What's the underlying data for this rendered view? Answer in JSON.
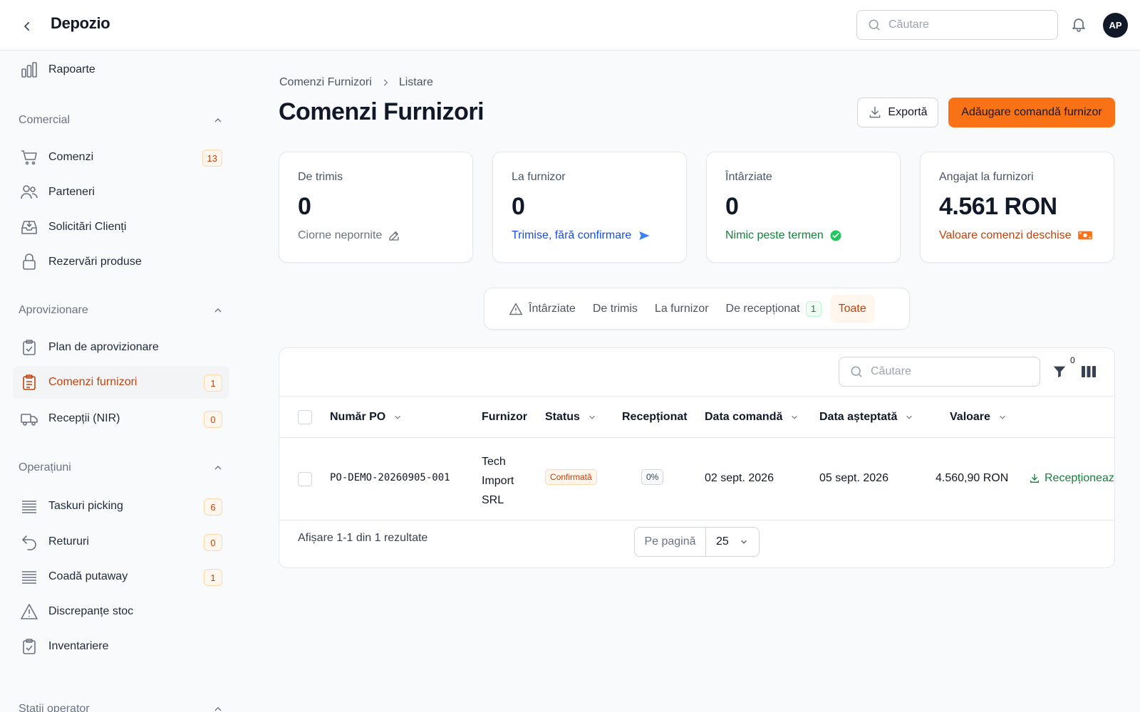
{
  "header": {
    "app_title": "Depozio",
    "search_placeholder": "Căutare",
    "avatar_initials": "AP"
  },
  "sidebar": {
    "top_item": "Rapoarte",
    "sections": [
      {
        "title": "Comercial",
        "items": [
          {
            "label": "Comenzi",
            "badge": "13",
            "icon": "cart-icon"
          },
          {
            "label": "Parteneri",
            "badge": "",
            "icon": "users-icon"
          },
          {
            "label": "Solicitări Clienți",
            "badge": "",
            "icon": "inbox-icon"
          },
          {
            "label": "Rezervări produse",
            "badge": "",
            "icon": "lock-icon"
          }
        ]
      },
      {
        "title": "Aprovizionare",
        "items": [
          {
            "label": "Plan de aprovizionare",
            "badge": "",
            "icon": "clipboard-check-icon"
          },
          {
            "label": "Comenzi furnizori",
            "badge": "1",
            "icon": "clipboard-list-icon",
            "active": true
          },
          {
            "label": "Recepții (NIR)",
            "badge": "0",
            "icon": "truck-icon"
          }
        ]
      },
      {
        "title": "Operațiuni",
        "items": [
          {
            "label": "Taskuri picking",
            "badge": "6",
            "icon": "list-icon"
          },
          {
            "label": "Retururi",
            "badge": "0",
            "icon": "return-icon"
          },
          {
            "label": "Coadă putaway",
            "badge": "1",
            "icon": "list-icon"
          },
          {
            "label": "Discrepanțe stoc",
            "badge": "",
            "icon": "warning-icon"
          },
          {
            "label": "Inventariere",
            "badge": "",
            "icon": "clipboard-check-icon"
          }
        ]
      },
      {
        "title": "Stații operator",
        "items": []
      }
    ]
  },
  "breadcrumb": {
    "parent": "Comenzi Furnizori",
    "current": "Listare"
  },
  "page": {
    "title": "Comenzi Furnizori",
    "export_label": "Exportă",
    "add_label": "Adăugare comandă furnizor"
  },
  "cards": [
    {
      "title": "De trimis",
      "value": "0",
      "sub": "Ciorne neporn­ite",
      "sub_color": "#6b7280"
    },
    {
      "title": "La furnizor",
      "value": "0",
      "sub": "Trimise, fără confirmare",
      "sub_color": "#1d4ed8"
    },
    {
      "title": "Întârziate",
      "value": "0",
      "sub": "Nimic peste termen",
      "sub_color": "#15803d"
    },
    {
      "title": "Angajat la furnizori",
      "value": "4.561 RON",
      "sub": "Valoare comenzi deschise",
      "sub_color": "#c2410c"
    }
  ],
  "tabs": [
    {
      "label": "Întârziate",
      "badge": ""
    },
    {
      "label": "De trimis",
      "badge": ""
    },
    {
      "label": "La furnizor",
      "badge": ""
    },
    {
      "label": "De recepționat",
      "badge": "1"
    },
    {
      "label": "Toate",
      "badge": "",
      "active": true
    }
  ],
  "table": {
    "search_placeholder": "Căutare",
    "filter_count": "0",
    "columns": [
      "Număr PO",
      "Furnizor",
      "Status",
      "Recepționat",
      "Data comandă",
      "Data așteptată",
      "Valoare"
    ],
    "rows": [
      {
        "po": "PO-DEMO-20260905-001",
        "supplier_lines": [
          "Tech",
          "Import",
          "SRL"
        ],
        "status": "Confirmată",
        "received": "0%",
        "order_date": "02 sept. 2026",
        "expected_date": "05 sept. 2026",
        "value": "4.560,90 RON",
        "action": "Recepționează"
      }
    ],
    "footer_text": "Afișare 1-1 din 1 rezultate",
    "per_page_label": "Pe pagină",
    "per_page_value": "25"
  }
}
